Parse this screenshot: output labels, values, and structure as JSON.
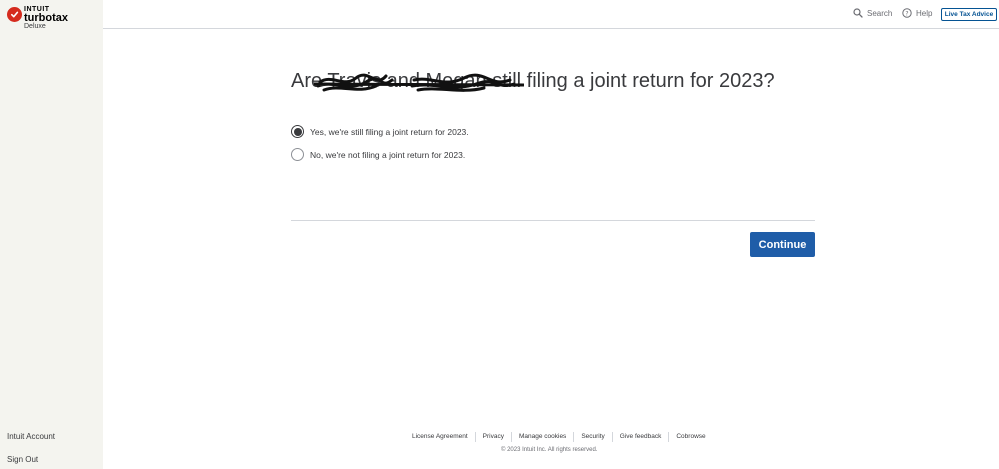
{
  "brand": {
    "company": "INTUIT",
    "product": "turbotax",
    "edition": "Deluxe"
  },
  "sidebar": {
    "account_link": "Intuit Account",
    "signout_link": "Sign Out"
  },
  "topbar": {
    "search_label": "Search",
    "help_label": "Help",
    "live_advice_label": "Live Tax Advice"
  },
  "main": {
    "question": "Are Travis and Megan still filing a joint return for 2023?",
    "options": [
      {
        "label": "Yes, we're still filing a joint return for 2023.",
        "selected": true
      },
      {
        "label": "No, we're not filing a joint return for 2023.",
        "selected": false
      }
    ],
    "continue_label": "Continue"
  },
  "footer": {
    "links": [
      "License Agreement",
      "Privacy",
      "Manage cookies",
      "Security",
      "Give feedback",
      "Cobrowse"
    ],
    "copyright": "© 2023 Intuit Inc. All rights reserved."
  },
  "colors": {
    "primary_blue": "#1f5da8",
    "brand_red": "#d52b1e",
    "sidebar_bg": "#f4f4ef"
  }
}
